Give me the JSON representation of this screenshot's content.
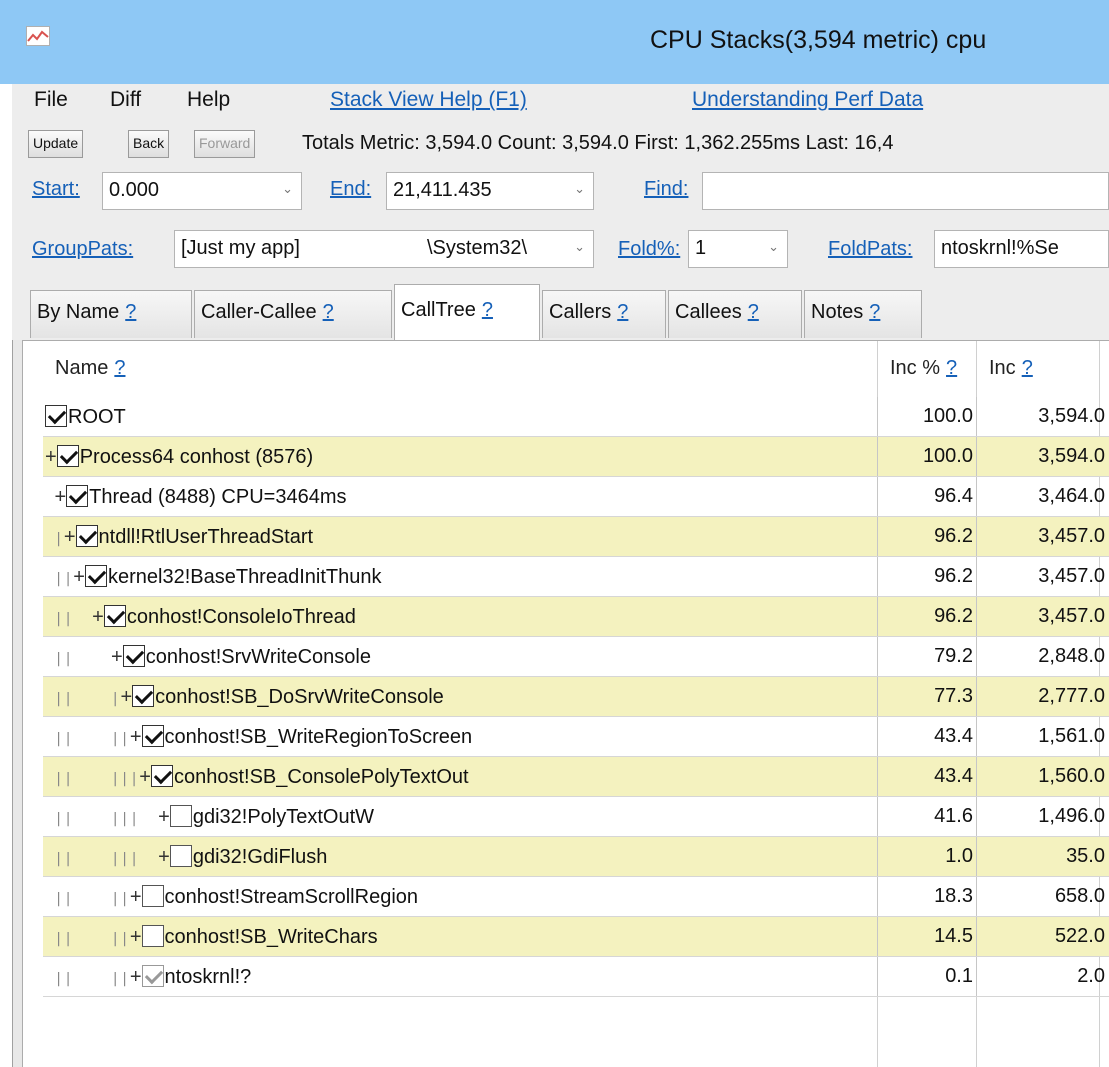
{
  "window": {
    "title": "CPU Stacks(3,594 metric) cpu"
  },
  "menu": {
    "file": "File",
    "diff": "Diff",
    "help": "Help",
    "stack_view_help": "Stack View Help (F1)",
    "understanding": "Understanding Perf Data"
  },
  "toolbar": {
    "update": "Update",
    "back": "Back",
    "forward": "Forward",
    "totals": "Totals Metric: 3,594.0  Count: 3,594.0  First: 1,362.255ms  Last: 16,4"
  },
  "filters": {
    "start_label": "Start:",
    "start_value": "0.000",
    "end_label": "End:",
    "end_value": "21,411.435",
    "find_label": "Find:",
    "find_value": ""
  },
  "grouping": {
    "grouppats_label": "GroupPats:",
    "grouppats_value": "[Just my app]",
    "grouppats_value2": "\\System32\\",
    "fold_label": "Fold%:",
    "fold_value": "1",
    "foldpats_label": "FoldPats:",
    "foldpats_value": "ntoskrnl!%Se"
  },
  "tabs": [
    {
      "label": "By Name",
      "help": "?"
    },
    {
      "label": "Caller-Callee",
      "help": "?"
    },
    {
      "label": "CallTree",
      "help": "?"
    },
    {
      "label": "Callers",
      "help": "?"
    },
    {
      "label": "Callees",
      "help": "?"
    },
    {
      "label": "Notes",
      "help": "?"
    }
  ],
  "active_tab": "CallTree",
  "columns": {
    "name": "Name",
    "inc_pct": "Inc %",
    "inc": "Inc",
    "help": "?"
  },
  "rows": [
    {
      "guide": "",
      "plus": "",
      "check": "checked",
      "name": "ROOT",
      "inc_pct": "100.0",
      "inc": "3,594.0"
    },
    {
      "guide": "",
      "plus": "+",
      "check": "checked",
      "name": "Process64 conhost (8576)",
      "inc_pct": "100.0",
      "inc": "3,594.0"
    },
    {
      "guide": " ",
      "plus": "+",
      "check": "checked",
      "name": "Thread (8488) CPU=3464ms",
      "inc_pct": "96.4",
      "inc": "3,464.0"
    },
    {
      "guide": " |",
      "plus": "+",
      "check": "checked",
      "name": "ntdll!RtlUserThreadStart",
      "inc_pct": "96.2",
      "inc": "3,457.0"
    },
    {
      "guide": " ||",
      "plus": "+",
      "check": "checked",
      "name": "kernel32!BaseThreadInitThunk",
      "inc_pct": "96.2",
      "inc": "3,457.0"
    },
    {
      "guide": " ||  ",
      "plus": "+",
      "check": "checked",
      "name": "conhost!ConsoleIoThread",
      "inc_pct": "96.2",
      "inc": "3,457.0"
    },
    {
      "guide": " ||    ",
      "plus": "+",
      "check": "checked",
      "name": "conhost!SrvWriteConsole",
      "inc_pct": "79.2",
      "inc": "2,848.0"
    },
    {
      "guide": " ||    |",
      "plus": "+",
      "check": "checked",
      "name": "conhost!SB_DoSrvWriteConsole",
      "inc_pct": "77.3",
      "inc": "2,777.0"
    },
    {
      "guide": " ||    ||",
      "plus": "+",
      "check": "checked",
      "name": "conhost!SB_WriteRegionToScreen",
      "inc_pct": "43.4",
      "inc": "1,561.0"
    },
    {
      "guide": " ||    |||",
      "plus": "+",
      "check": "checked",
      "name": "conhost!SB_ConsolePolyTextOut",
      "inc_pct": "43.4",
      "inc": "1,560.0"
    },
    {
      "guide": " ||    |||  ",
      "plus": "+",
      "check": "empty",
      "name": "gdi32!PolyTextOutW",
      "inc_pct": "41.6",
      "inc": "1,496.0"
    },
    {
      "guide": " ||    |||  ",
      "plus": "+",
      "check": "empty",
      "name": "gdi32!GdiFlush",
      "inc_pct": "1.0",
      "inc": "35.0"
    },
    {
      "guide": " ||    ||",
      "plus": "+",
      "check": "empty",
      "name": "conhost!StreamScrollRegion",
      "inc_pct": "18.3",
      "inc": "658.0"
    },
    {
      "guide": " ||    ||",
      "plus": "+",
      "check": "empty",
      "name": "conhost!SB_WriteChars",
      "inc_pct": "14.5",
      "inc": "522.0"
    },
    {
      "guide": " ||    ||",
      "plus": "+",
      "check": "grey",
      "name": "ntoskrnl!?",
      "inc_pct": "0.1",
      "inc": "2.0"
    }
  ],
  "colors": {
    "titlebar": "#8ec8f5",
    "row_highlight": "#f4f2bf",
    "link": "#1560b8"
  }
}
